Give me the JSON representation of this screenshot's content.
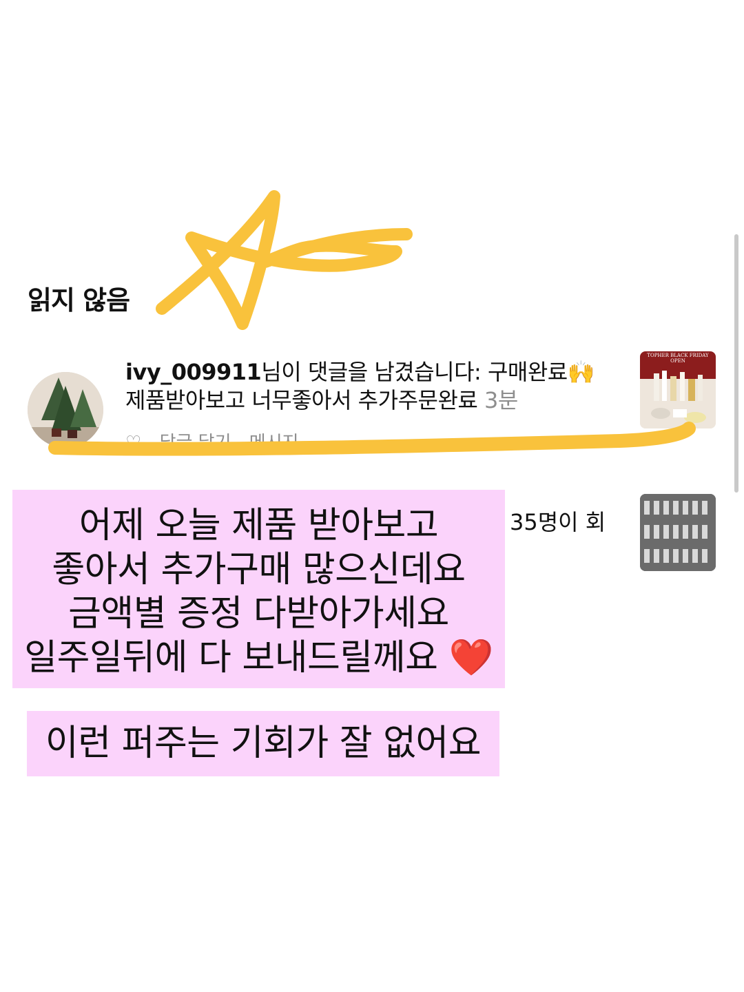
{
  "section": {
    "title": "읽지 않음"
  },
  "notification": {
    "username": "ivy_009911",
    "message_prefix": "님이 댓글을 남겼습니다: 구매완료🙌",
    "message_line2": "제품받아보고 너무좋아서  추가주문완료",
    "time": "3분",
    "actions": [
      "답글 달기",
      "메시지"
    ],
    "thumbnail_text": [
      "TOPHER BLACK FRIDAY",
      "OPEN"
    ]
  },
  "notification2": {
    "text": "35명이 회"
  },
  "captions": {
    "box1_lines": [
      "어제 오늘  제품  받아보고",
      "좋아서 추가구매 많으신데요",
      "금액별  증정  다받아가세요",
      "일주일뒤에 다 보내드릴께요"
    ],
    "box1_emoji": "❤️",
    "box2": "이런 퍼주는 기회가 잘 없어요"
  },
  "colors": {
    "highlight_pink": "#fbd3fb",
    "marker_yellow": "#f9c23c",
    "timestamp_gray": "#8e8e8e"
  }
}
